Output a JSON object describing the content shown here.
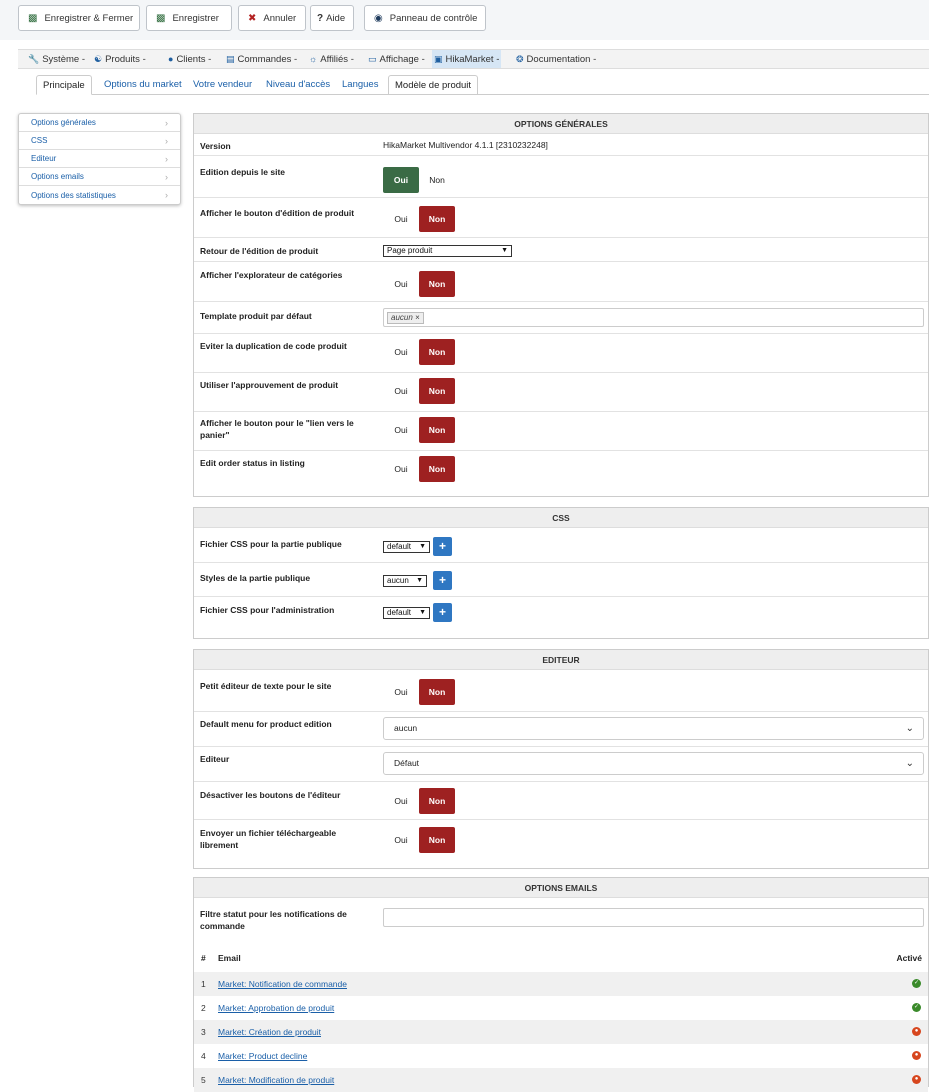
{
  "toolbar": {
    "save_close": "Enregistrer & Fermer",
    "save": "Enregistrer",
    "cancel": "Annuler",
    "help": "Aide",
    "dashboard": "Panneau de contrôle"
  },
  "menu": [
    {
      "label": "Système -",
      "icon": "wrench-icon"
    },
    {
      "label": "Produits -",
      "icon": "products-icon"
    },
    {
      "label": "Clients -",
      "icon": "user-icon"
    },
    {
      "label": "Commandes -",
      "icon": "orders-icon"
    },
    {
      "label": "Affiliés -",
      "icon": "affiliates-icon"
    },
    {
      "label": "Affichage -",
      "icon": "display-icon"
    },
    {
      "label": "HikaMarket -",
      "icon": "market-icon"
    },
    {
      "label": "Documentation -",
      "icon": "help-circle-icon"
    }
  ],
  "tabs": [
    "Principale",
    "Options du market",
    "Votre vendeur",
    "Niveau d'accès",
    "Langues",
    "Modèle de produit"
  ],
  "sidebar": [
    "Options générales",
    "CSS",
    "Editeur",
    "Options emails",
    "Options des statistiques"
  ],
  "general": {
    "title": "OPTIONS GÉNÉRALES",
    "version_label": "Version",
    "version_value": "HikaMarket Multivendor 4.1.1 [2310232248]",
    "edit_site_label": "Edition depuis le site",
    "show_edit_btn_label": "Afficher le bouton d'édition de produit",
    "return_edit_label": "Retour de l'édition de produit",
    "return_edit_value": "Page produit",
    "cat_explorer_label": "Afficher l'explorateur de catégories",
    "template_label": "Template produit par défaut",
    "template_tag": "aucun ×",
    "dup_code_label": "Eviter la duplication de code produit",
    "approval_label": "Utiliser l'approuvement de produit",
    "cart_link_label": "Afficher le bouton pour le \"lien vers le panier\"",
    "order_status_label": "Edit order status in listing"
  },
  "yes": "Oui",
  "no": "Non",
  "css": {
    "title": "CSS",
    "public_file_label": "Fichier CSS pour la partie publique",
    "public_file_value": "default",
    "public_styles_label": "Styles de la partie publique",
    "public_styles_value": "aucun",
    "admin_file_label": "Fichier CSS pour l'administration",
    "admin_file_value": "default"
  },
  "editor": {
    "title": "EDITEUR",
    "small_editor_label": "Petit éditeur de texte pour le site",
    "default_menu_label": "Default menu for product edition",
    "default_menu_value": "aucun",
    "editor_label": "Editeur",
    "editor_value": "Défaut",
    "disable_buttons_label": "Désactiver les boutons de l'éditeur",
    "free_download_label": "Envoyer un fichier téléchargeable librement"
  },
  "emails": {
    "title": "OPTIONS EMAILS",
    "filter_label": "Filtre statut pour les notifications de commande",
    "col_num": "#",
    "col_email": "Email",
    "col_active": "Activé",
    "rows": [
      {
        "num": "1",
        "name": "Market: Notification de commande",
        "active": true
      },
      {
        "num": "2",
        "name": "Market: Approbation de produit",
        "active": true
      },
      {
        "num": "3",
        "name": "Market: Création de produit",
        "active": false
      },
      {
        "num": "4",
        "name": "Market: Product decline",
        "active": false
      },
      {
        "num": "5",
        "name": "Market: Modification de produit",
        "active": false
      }
    ]
  }
}
